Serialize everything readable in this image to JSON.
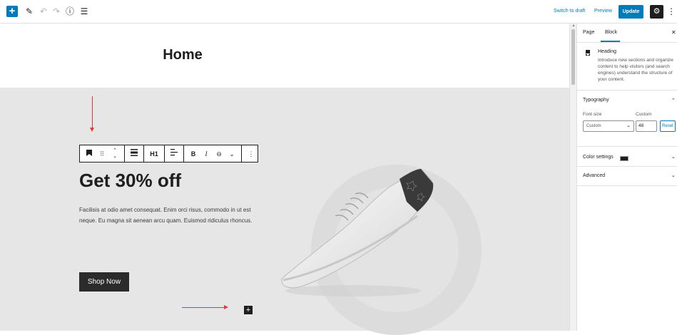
{
  "topbar": {
    "add_label": "+",
    "switch_to_draft": "Switch to draft",
    "preview": "Preview",
    "update": "Update"
  },
  "page": {
    "title": "Home"
  },
  "hero": {
    "heading": "Get 30% off",
    "paragraph": "Facilisis at odio amet consequat. Enim orci risus, commodo in ut est neque. Eu magna sit aenean arcu quam. Euismod ridiculus rhoncus.",
    "button": "Shop Now"
  },
  "block_toolbar": {
    "heading_level": "H1",
    "bold": "B",
    "italic": "I"
  },
  "sidebar": {
    "tabs": [
      {
        "label": "Page"
      },
      {
        "label": "Block"
      }
    ],
    "active_tab": "Block",
    "block": {
      "name": "Heading",
      "description": "Introduce new sections and organize content to help visitors (and search engines) understand the structure of your content."
    },
    "typography": {
      "title": "Typography",
      "font_size_label": "Font size",
      "custom_label": "Custom",
      "font_size_select": "Custom",
      "font_size_value": "48",
      "reset": "Reset"
    },
    "color_settings": "Color settings",
    "color_swatch": "#1e1e1e",
    "advanced": "Advanced"
  },
  "colors": {
    "accent": "#007cba",
    "hero_bg": "#e6e6e6",
    "annotation_arrow": "#e53935"
  }
}
